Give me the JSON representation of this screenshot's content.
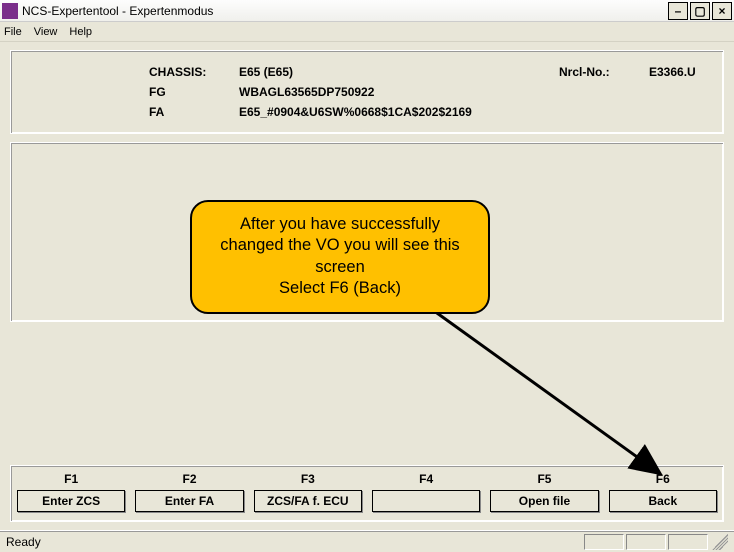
{
  "window": {
    "title": "NCS-Expertentool - Expertenmodus"
  },
  "menu": {
    "file": "File",
    "view": "View",
    "help": "Help"
  },
  "info": {
    "chassis_label": "CHASSIS:",
    "chassis_value": "E65 (E65)",
    "nrcl_label": "Nrcl-No.:",
    "nrcl_value": "E3366.U",
    "fg_label": "FG",
    "fg_value": "WBAGL63565DP750922",
    "fa_label": "FA",
    "fa_value": "E65_#0904&U6SW%0668$1CA$202$2169"
  },
  "callout": {
    "line1": "After you have successfully",
    "line2": "changed the VO you will see this",
    "line3": "screen",
    "line4": "Select F6 (Back)"
  },
  "fkeys": [
    {
      "key": "F1",
      "label": "Enter ZCS"
    },
    {
      "key": "F2",
      "label": "Enter FA"
    },
    {
      "key": "F3",
      "label": "ZCS/FA f. ECU"
    },
    {
      "key": "F4",
      "label": ""
    },
    {
      "key": "F5",
      "label": "Open file"
    },
    {
      "key": "F6",
      "label": "Back"
    }
  ],
  "status": {
    "text": "Ready"
  }
}
